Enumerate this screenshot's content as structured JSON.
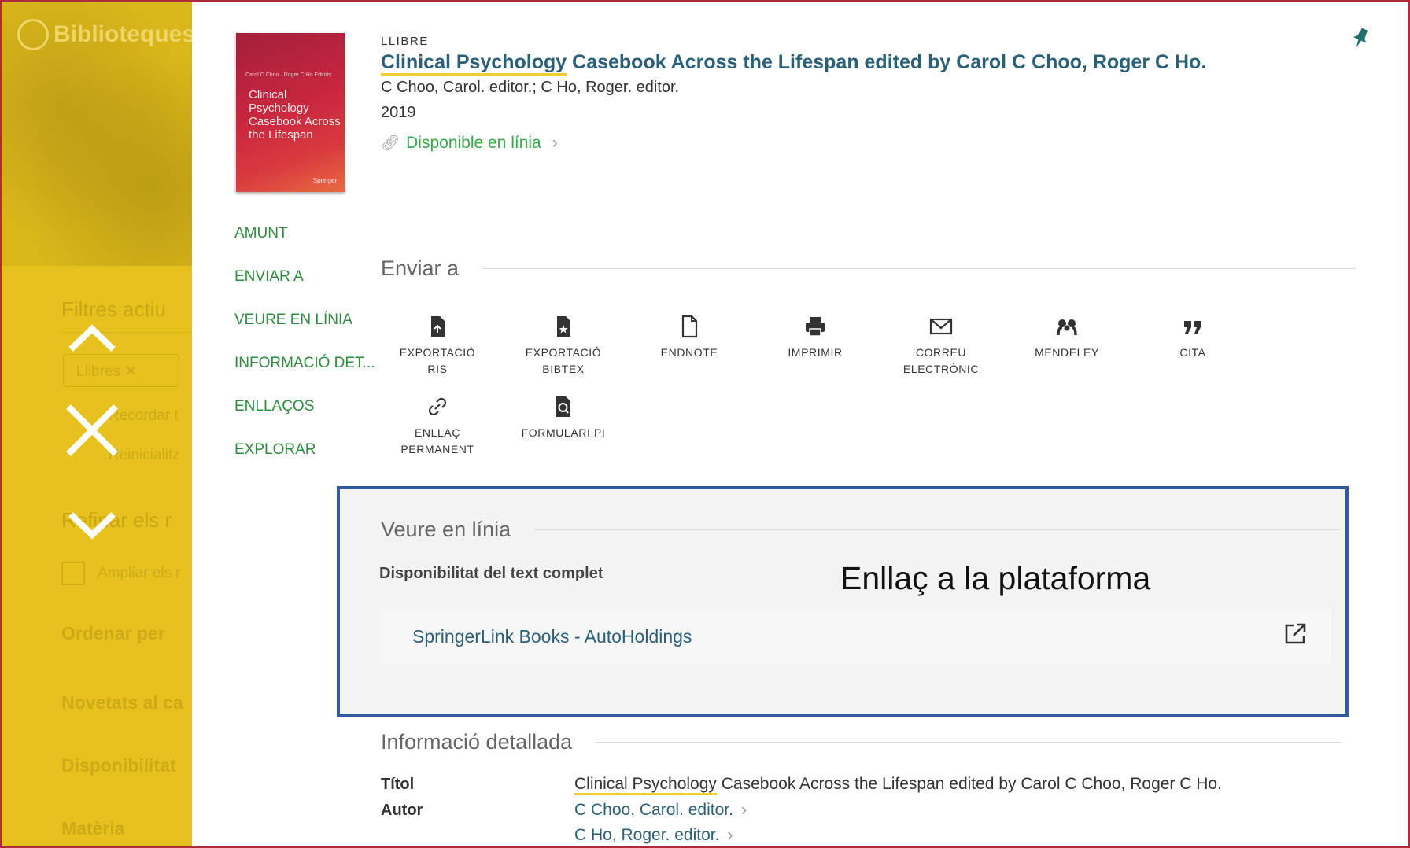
{
  "background": {
    "logo_text": "Biblioteques",
    "active_filters_heading": "Filtres actiu",
    "filter_chip": "Llibres",
    "remember_label": "Recordar t",
    "reset_label": "Reinicialitz",
    "refine_heading": "Refinar els r",
    "expand_label": "Ampliar els r",
    "sort_label": "Ordenar per",
    "new_label": "Novetats al ca",
    "availability_label": "Disponibilitat",
    "subject_label": "Matèria"
  },
  "record": {
    "type": "LLIBRE",
    "title_highlight": "Clinical Psychology",
    "title_rest": " Casebook Across the Lifespan edited by Carol C Choo, Roger C Ho.",
    "authors": "C Choo, Carol. editor.; C Ho, Roger. editor.",
    "year": "2019",
    "availability": "Disponible en línia",
    "cover": {
      "authors": "Carol C Choo · Roger C Ho  Editors",
      "title": "Clinical Psychology Casebook Across the Lifespan",
      "publisher": "Springer"
    }
  },
  "section_nav": [
    "AMUNT",
    "ENVIAR A",
    "VEURE EN LÍNIA",
    "INFORMACIÓ DET...",
    "ENLLAÇOS",
    "EXPLORAR"
  ],
  "send_to": {
    "heading": "Enviar a",
    "actions": [
      {
        "label1": "EXPORTACIÓ",
        "label2": "RIS",
        "icon": "export-file-icon"
      },
      {
        "label1": "EXPORTACIÓ",
        "label2": "BIBTEX",
        "icon": "export-file-icon"
      },
      {
        "label1": "ENDNOTE",
        "label2": "",
        "icon": "document-icon"
      },
      {
        "label1": "IMPRIMIR",
        "label2": "",
        "icon": "printer-icon"
      },
      {
        "label1": "CORREU",
        "label2": "ELECTRÒNIC",
        "icon": "envelope-icon"
      },
      {
        "label1": "MENDELEY",
        "label2": "",
        "icon": "mendeley-icon"
      },
      {
        "label1": "CITA",
        "label2": "",
        "icon": "quote-icon"
      },
      {
        "label1": "ENLLAÇ",
        "label2": "PERMANENT",
        "icon": "link-icon"
      },
      {
        "label1": "FORMULARI PI",
        "label2": "",
        "icon": "search-document-icon"
      }
    ]
  },
  "online": {
    "heading": "Veure en línia",
    "availability_label": "Disponibilitat del text complet",
    "callout": "Enllaç a la plataforma",
    "service_link": "SpringerLink Books - AutoHoldings"
  },
  "details": {
    "heading": "Informació detallada",
    "title_label": "Títol",
    "title_highlight": "Clinical Psychology",
    "title_rest": " Casebook Across the Lifespan edited by Carol C Choo, Roger C Ho.",
    "author_label": "Autor",
    "authors": [
      "C Choo, Carol. editor.",
      "C Ho, Roger. editor."
    ]
  },
  "colors": {
    "accent_yellow": "#e7c21e",
    "link_teal": "#2b5f78",
    "green": "#2e8b3f",
    "callout_border": "#2f5aa0"
  }
}
